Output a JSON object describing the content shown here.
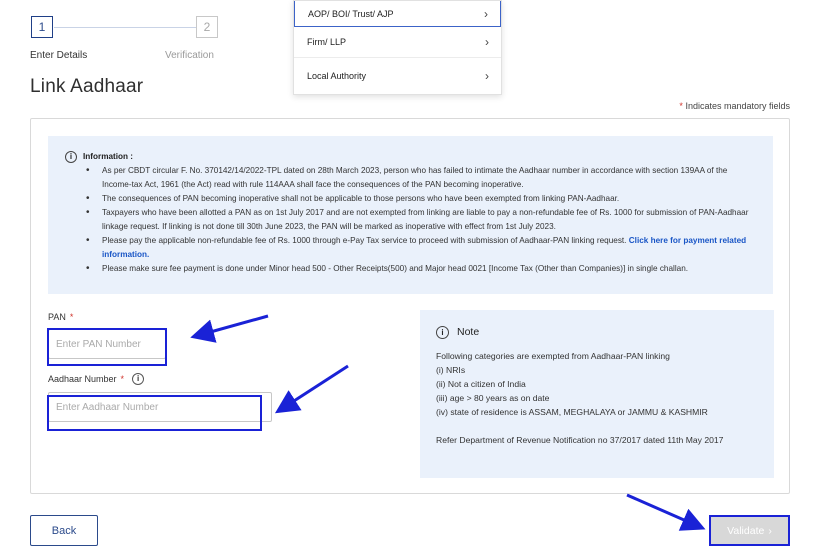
{
  "stepper": {
    "step1_number": "1",
    "step1_label": "Enter Details",
    "step2_number": "2",
    "step2_label": "Verification"
  },
  "page_title": "Link Aadhaar",
  "mandatory_note": {
    "asterisk": "*",
    "text": " Indicates mandatory fields"
  },
  "info": {
    "icon": "info-icon",
    "title": "Information :",
    "items": [
      "As per CBDT circular F. No. 370142/14/2022-TPL dated on 28th March 2023, person who has failed to intimate the Aadhaar number in accordance with section 139AA of the Income-tax Act, 1961 (the Act) read with rule 114AAA shall face the consequences of the PAN becoming inoperative.",
      "The consequences of PAN becoming inoperative shall not be applicable to those persons who have been exempted from linking PAN-Aadhaar.",
      "Taxpayers who have been allotted a PAN as on 1st July 2017 and are not exempted from linking are liable to pay a non-refundable fee of Rs. 1000 for submission of PAN-Aadhaar linkage request. If linking is not done till 30th June 2023, the PAN will be marked as inoperative with effect from 1st July 2023.",
      "Please pay the applicable non-refundable fee of Rs. 1000 through e-Pay Tax service to proceed with submission of Aadhaar-PAN linking request.",
      "Please make sure fee payment is done under Minor head 500 - Other Receipts(500) and Major head 0021 [Income Tax (Other than Companies)] in single challan."
    ],
    "link_text": "Click here for payment related information."
  },
  "form": {
    "pan_label": "PAN",
    "pan_required": "*",
    "pan_placeholder": "Enter PAN Number",
    "aadhaar_label": "Aadhaar Number",
    "aadhaar_required": "*",
    "aadhaar_placeholder": "Enter Aadhaar Number",
    "help_icon": "info-icon"
  },
  "note": {
    "title": "Note",
    "intro": "Following categories are exempted from Aadhaar-PAN linking",
    "items": [
      "(i) NRIs",
      "(ii) Not a citizen of India",
      "(iii) age > 80 years as on date",
      "(iv) state of residence is ASSAM, MEGHALAYA or JAMMU & KASHMIR"
    ],
    "footer": "Refer Department of Revenue Notification no 37/2017 dated 11th May 2017"
  },
  "buttons": {
    "back": "Back",
    "validate": "Validate",
    "validate_chevron": "›"
  },
  "dropdown": {
    "items": [
      {
        "label": "AOP/ BOI/ Trust/ AJP",
        "chevron": "›"
      },
      {
        "label": "Firm/ LLP",
        "chevron": "›"
      },
      {
        "label": "Local Authority",
        "chevron": "›"
      }
    ]
  },
  "colors": {
    "primary": "#2b4a8b",
    "annotation": "#1a22d6",
    "panel_bg": "#eaf1fb",
    "required": "#d0342c",
    "link": "#1a56c6"
  }
}
